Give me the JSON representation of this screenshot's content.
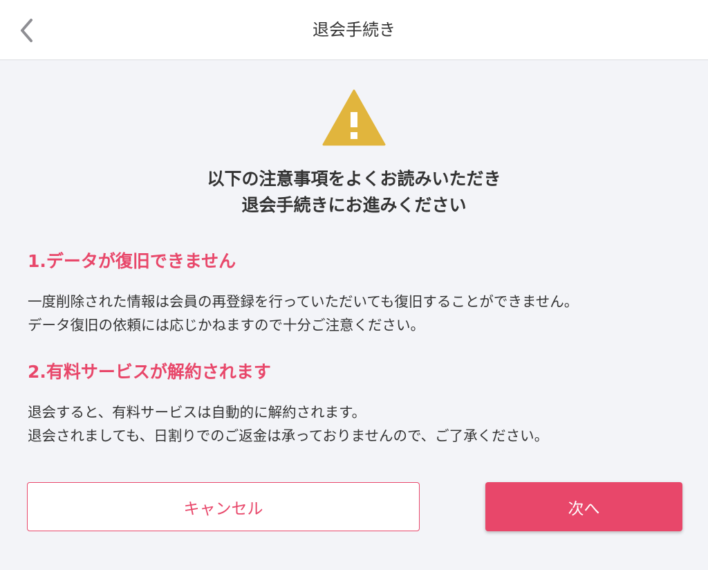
{
  "header": {
    "title": "退会手続き",
    "back_icon": "chevron-left-icon"
  },
  "warning": {
    "icon": "warning-triangle-icon",
    "icon_color": "#e1b53d",
    "lines": [
      "以下の注意事項をよくお読みいただき",
      "退会手続きにお進みください"
    ]
  },
  "sections": [
    {
      "heading": "1.データが復旧できません",
      "body": [
        "一度削除された情報は会員の再登録を行っていただいても復旧することができません。",
        "データ復旧の依頼には応じかねますので十分ご注意ください。"
      ]
    },
    {
      "heading": "2.有料サービスが解約されます",
      "body": [
        "退会すると、有料サービスは自動的に解約されます。",
        "退会されましても、日割りでのご返金は承っておりませんので、ご了承ください。"
      ]
    }
  ],
  "buttons": {
    "cancel": "キャンセル",
    "next": "次へ"
  },
  "colors": {
    "accent": "#e8476a",
    "warning": "#e1b53d",
    "background": "#f3f4f8"
  }
}
